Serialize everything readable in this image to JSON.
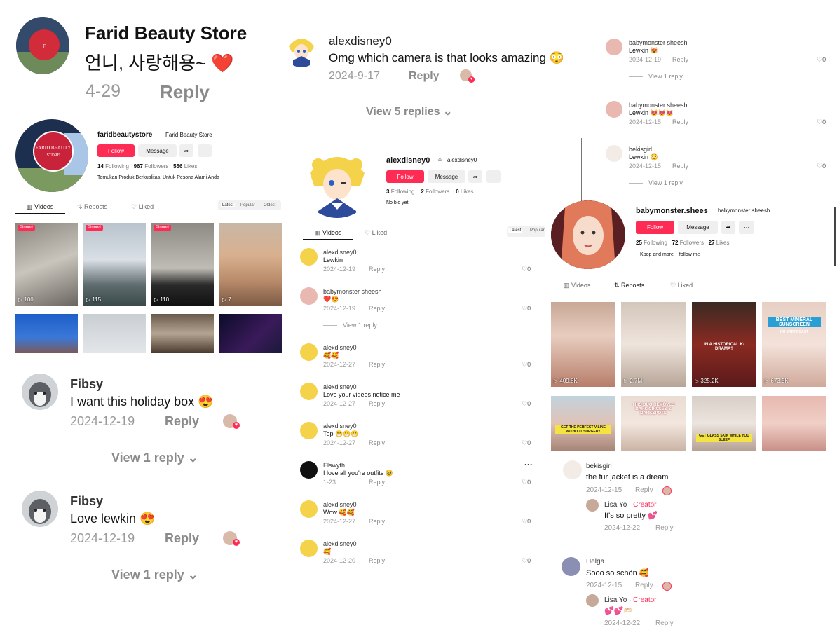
{
  "c1": {
    "name": "Farid Beauty Store",
    "text": "언니, 사랑해용~ ❤️",
    "date": "4-29",
    "reply": "Reply"
  },
  "p1": {
    "username": "faridbeautystore",
    "nickname": "Farid Beauty Store",
    "follow": "Follow",
    "message": "Message",
    "following_n": "14",
    "following_l": "Following",
    "followers_n": "967",
    "followers_l": "Followers",
    "likes_n": "556",
    "likes_l": "Likes",
    "bio": "Temukan Produk Berkualitas, Untuk Pesona Alami Anda",
    "logo_text": "FARID BEAUTY STORE",
    "tabs": [
      "Videos",
      "Reposts",
      "Liked"
    ],
    "sort": [
      "Latest",
      "Popular",
      "Oldest"
    ],
    "pinned": "Pinned",
    "views": [
      "100",
      "115",
      "110",
      "7"
    ]
  },
  "c2": {
    "name": "Fibsy",
    "text": "I want this holiday box 😍",
    "date": "2024-12-19",
    "reply": "Reply",
    "view": "View 1 reply"
  },
  "c3": {
    "name": "Fibsy",
    "text": "Love lewkin 😍",
    "date": "2024-12-19",
    "reply": "Reply",
    "view": "View 1 reply"
  },
  "c4": {
    "name": "alexdisney0",
    "text": "Omg which camera is that looks amazing 😳",
    "date": "2024-9-17",
    "reply": "Reply",
    "view": "View 5 replies"
  },
  "p2": {
    "username": "alexdisney0",
    "nickname": "alexdisney0",
    "follow": "Follow",
    "message": "Message",
    "following_n": "3",
    "following_l": "Following",
    "followers_n": "2",
    "followers_l": "Followers",
    "likes_n": "0",
    "likes_l": "Likes",
    "bio": "No bio yet.",
    "tabs": [
      "Videos",
      "Liked"
    ],
    "sort": [
      "Latest",
      "Popular"
    ]
  },
  "mid_comments": [
    {
      "name": "alexdisney0",
      "text": "Lewkin",
      "date": "2024-12-19",
      "reply": "Reply",
      "likes": "0"
    },
    {
      "name": "babymonster sheesh",
      "text": "❤️😍",
      "date": "2024-12-19",
      "reply": "Reply",
      "likes": "0",
      "view": "View 1 reply"
    },
    {
      "name": "alexdisney0",
      "text": "🥰🥰",
      "date": "2024-12-27",
      "reply": "Reply",
      "likes": "0"
    },
    {
      "name": "alexdisney0",
      "text": "Love your videos notice me",
      "date": "2024-12-27",
      "reply": "Reply",
      "likes": "0"
    },
    {
      "name": "alexdisney0",
      "text": "Top 😁😁😁",
      "date": "2024-12-27",
      "reply": "Reply",
      "likes": "0"
    },
    {
      "name": "Elswyth",
      "text": "I love all you're outfits 🥹",
      "date": "1-23",
      "reply": "Reply",
      "likes": "0",
      "more": "···"
    },
    {
      "name": "alexdisney0",
      "text": "Wow 🥰🥰",
      "date": "2024-12-27",
      "reply": "Reply",
      "likes": "0"
    },
    {
      "name": "alexdisney0",
      "text": "🥰",
      "date": "2024-12-20",
      "reply": "Reply",
      "likes": "0"
    }
  ],
  "right_comments": [
    {
      "name": "babymonster sheesh",
      "text": "Lewkin 😻",
      "date": "2024-12-19",
      "reply": "Reply",
      "likes": "0",
      "view": "View 1 reply"
    },
    {
      "name": "babymonster sheesh",
      "text": "Lewkin 😻😻😻",
      "date": "2024-12-15",
      "reply": "Reply",
      "likes": "0"
    },
    {
      "name": "bekisgirl",
      "text": "Lewkin 😳",
      "date": "2024-12-15",
      "reply": "Reply",
      "likes": "0",
      "view": "View 1 reply"
    }
  ],
  "p3": {
    "username": "babymonster.shees",
    "nickname": "babymonster sheesh",
    "follow": "Follow",
    "message": "Message",
    "following_n": "25",
    "following_l": "Following",
    "followers_n": "72",
    "followers_l": "Followers",
    "likes_n": "27",
    "likes_l": "Likes",
    "bio": "~ Kpop and more ~ follow me",
    "tabs": [
      "Videos",
      "Reposts",
      "Liked"
    ],
    "views": [
      "409.8K",
      "2.7M",
      "325.2K",
      "673.5K"
    ],
    "thumb_texts": [
      "BEST MINERAL SUNSCREEN",
      "NO WHITE CAST",
      "THIS DUO REMOVES DARK CIRCLES & DARKSPOTS",
      "GET THE PERFECT V-LINE WITHOUT SURGERY",
      "GET GLASS SKIN WHILE YOU SLEEP",
      "IN A HISTORICAL K-DRAMA?"
    ]
  },
  "br1": {
    "name": "bekisgirl",
    "text": "the fur jacket is a dream",
    "date": "2024-12-15",
    "reply": "Reply",
    "sub_name": "Lisa Yo",
    "sub_tag": "Creator",
    "sub_text": "It's so pretty 💕",
    "sub_date": "2024-12-22",
    "sub_reply": "Reply"
  },
  "br2": {
    "name": "Helga",
    "text": "Sooo so schön 🥰",
    "date": "2024-12-15",
    "reply": "Reply",
    "sub_name": "Lisa Yo",
    "sub_tag": "Creator",
    "sub_text": "💕💕🫶🏻",
    "sub_date": "2024-12-22",
    "sub_reply": "Reply"
  },
  "colors": {
    "accent": "#fe2c55",
    "gray_text": "#9a9a9a",
    "creator": "#fe2c55"
  }
}
